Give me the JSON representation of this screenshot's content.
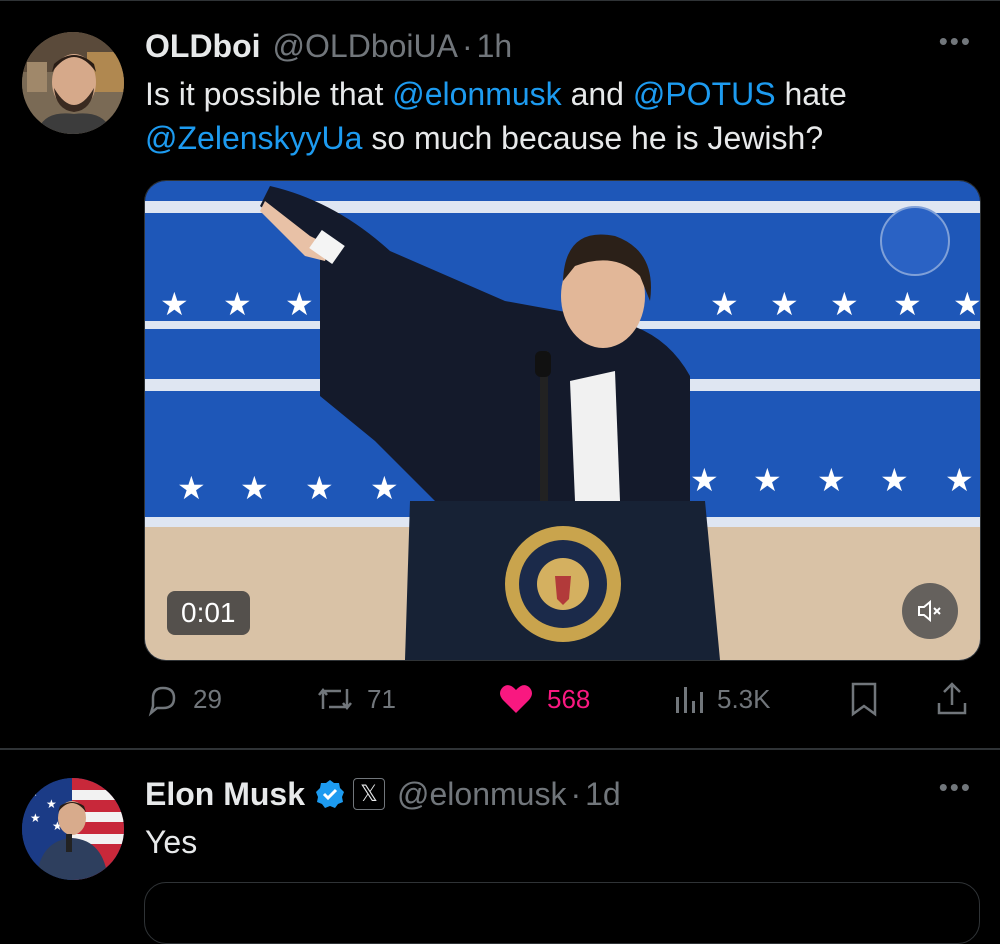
{
  "tweets": [
    {
      "author_name": "OLDboi",
      "handle": "@OLDboiUA",
      "separator": "·",
      "time": "1h",
      "more": "•••",
      "text_parts": {
        "p1": "Is it possible that ",
        "m1": "@elonmusk",
        "p2": " and ",
        "m2": "@POTUS",
        "p3": " hate ",
        "m3": "@ZelenskyyUa",
        "p4": " so much because he is Jewish?"
      },
      "video": {
        "duration": "0:01",
        "muted": true
      },
      "metrics": {
        "replies": "29",
        "reposts": "71",
        "likes": "568",
        "views": "5.3K",
        "liked": true
      }
    },
    {
      "author_name": "Elon Musk",
      "verified": true,
      "affiliate_badge": "𝕏",
      "handle": "@elonmusk",
      "separator": "·",
      "time": "1d",
      "more": "•••",
      "text": "Yes"
    }
  ],
  "colors": {
    "background": "#000000",
    "text": "#e7e9ea",
    "muted": "#71767b",
    "link": "#1d9bf0",
    "like": "#f91880",
    "verified": "#1d9bf0",
    "divider": "#2f3336"
  },
  "icons": [
    "reply-icon",
    "repost-icon",
    "like-icon",
    "views-icon",
    "bookmark-icon",
    "share-icon",
    "mute-icon",
    "verified-badge-icon",
    "more-icon"
  ]
}
